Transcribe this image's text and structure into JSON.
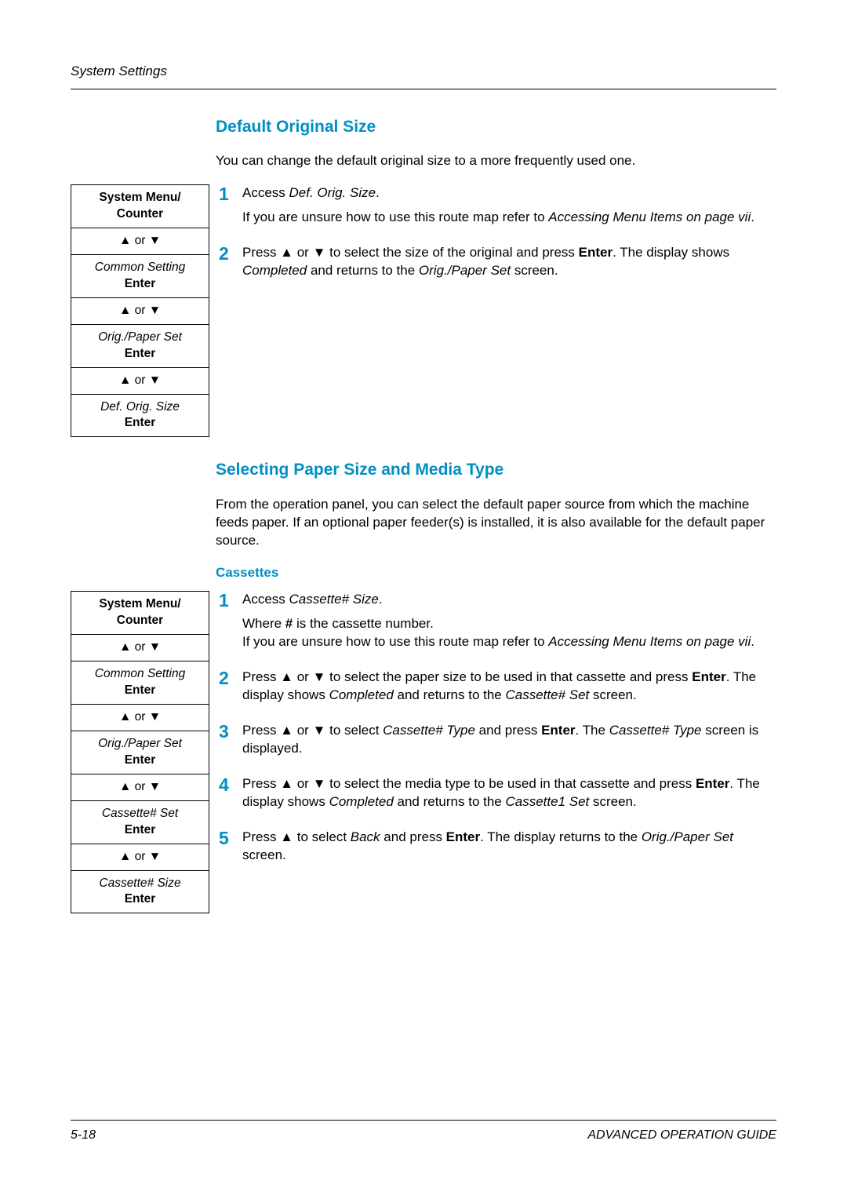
{
  "header": "System Settings",
  "section1": {
    "heading": "Default Original Size",
    "intro": "You can change the default original size to a more frequently used one.",
    "routeMap": {
      "r1a": "System Menu/",
      "r1b": "Counter",
      "arrow": "▲ or ▼",
      "r2a": "Common Setting",
      "r2b": "Enter",
      "r3a": "Orig./Paper Set",
      "r3b": "Enter",
      "r4a": "Def. Orig. Size",
      "r4b": "Enter"
    },
    "steps": {
      "s1n": "1",
      "s1a": "Access ",
      "s1b": "Def. Orig. Size",
      "s1c": ".",
      "s1d": "If you are unsure how to use this route map refer to ",
      "s1e": "Accessing Menu Items on page vii",
      "s1f": ".",
      "s2n": "2",
      "s2a": "Press ▲ or ▼ to select the size of the original and press ",
      "s2b": "Enter",
      "s2c": ". The display shows ",
      "s2d": "Completed",
      "s2e": " and returns to the ",
      "s2f": "Orig./Paper Set",
      "s2g": " screen."
    }
  },
  "section2": {
    "heading": "Selecting Paper Size and Media Type",
    "intro": "From the operation panel, you can select the default paper source from which the machine feeds paper. If an optional paper feeder(s) is installed, it is also available for the default paper source.",
    "subheading": "Cassettes",
    "routeMap": {
      "r1a": "System Menu/",
      "r1b": "Counter",
      "arrow": "▲ or ▼",
      "r2a": "Common Setting",
      "r2b": "Enter",
      "r3a": "Orig./Paper Set",
      "r3b": "Enter",
      "r4a": "Cassette# Set",
      "r4b": "Enter",
      "r5a": "Cassette# Size",
      "r5b": "Enter"
    },
    "steps": {
      "s1n": "1",
      "s1a": "Access ",
      "s1b": "Cassette# Size",
      "s1c": ".",
      "s1d": "Where ",
      "s1e": "#",
      "s1f": " is the cassette number.",
      "s1g": "If you are unsure how to use this route map refer to ",
      "s1h": "Accessing Menu Items on page vii",
      "s1i": ".",
      "s2n": "2",
      "s2a": "Press ▲ or ▼ to select the paper size to be used in that cassette and press ",
      "s2b": "Enter",
      "s2c": ". The display shows ",
      "s2d": "Completed",
      "s2e": " and returns to the ",
      "s2f": "Cassette# Set",
      "s2g": " screen.",
      "s3n": "3",
      "s3a": "Press ▲ or ▼ to select ",
      "s3b": "Cassette# Type",
      "s3c": " and press ",
      "s3d": "Enter",
      "s3e": ". The ",
      "s3f": "Cassette# Type",
      "s3g": " screen is displayed.",
      "s4n": "4",
      "s4a": "Press ▲ or ▼ to select the media type to be used in that cassette and press ",
      "s4b": "Enter",
      "s4c": ". The display shows ",
      "s4d": "Completed",
      "s4e": " and returns to the ",
      "s4f": "Cassette1 Set",
      "s4g": " screen.",
      "s5n": "5",
      "s5a": "Press ▲ to select ",
      "s5b": "Back",
      "s5c": " and press ",
      "s5d": "Enter",
      "s5e": ". The display returns to the ",
      "s5f": "Orig./Paper Set",
      "s5g": " screen."
    }
  },
  "footer": {
    "left": "5-18",
    "right": "ADVANCED OPERATION GUIDE"
  }
}
